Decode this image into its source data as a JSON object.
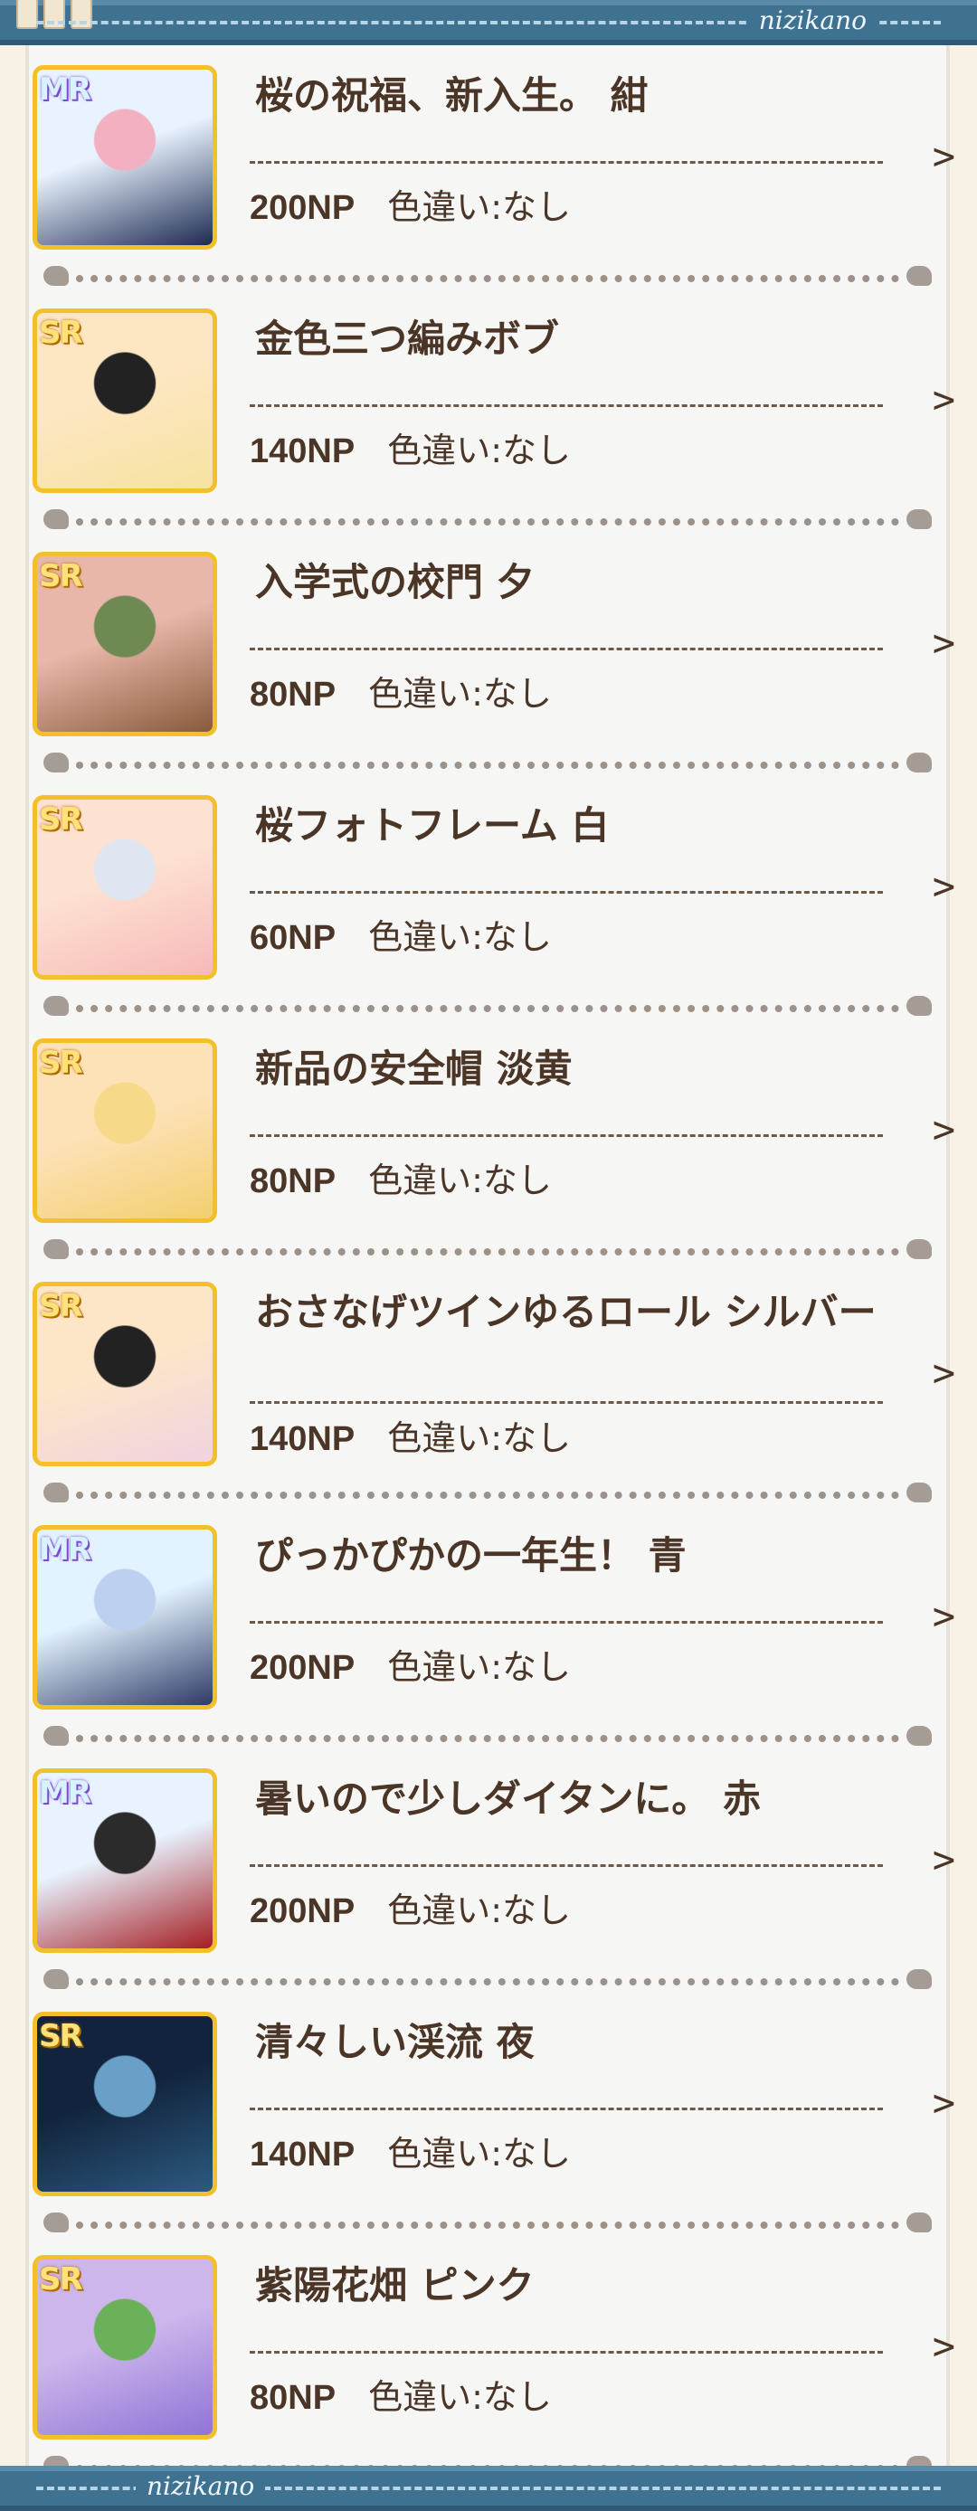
{
  "header": {
    "brand": "nizikano"
  },
  "footer": {
    "brand": "nizikano"
  },
  "items": [
    {
      "rarity": "MR",
      "name": "桜の祝福、新入生。 紺",
      "price": "200NP",
      "variant": "色違い:なし",
      "colors": [
        "#e9f3ff",
        "#1d2b52",
        "#f3b0c0"
      ]
    },
    {
      "rarity": "SR",
      "name": "金色三つ編みボブ",
      "price": "140NP",
      "variant": "色違い:なし",
      "colors": [
        "#fde6c2",
        "#f6e3a0",
        "#222222"
      ]
    },
    {
      "rarity": "SR",
      "name": "入学式の校門 夕",
      "price": "80NP",
      "variant": "色違い:なし",
      "colors": [
        "#e8b7a9",
        "#8a5a3c",
        "#6e8a52"
      ]
    },
    {
      "rarity": "SR",
      "name": "桜フォトフレーム 白",
      "price": "60NP",
      "variant": "色違い:なし",
      "colors": [
        "#fde1d1",
        "#f7b9b9",
        "#dfe6f2"
      ]
    },
    {
      "rarity": "SR",
      "name": "新品の安全帽 淡黄",
      "price": "80NP",
      "variant": "色違い:なし",
      "colors": [
        "#fde2b8",
        "#f3cf70",
        "#f7d98a"
      ]
    },
    {
      "rarity": "SR",
      "name": "おさなげツインゆるロール シルバー",
      "price": "140NP",
      "variant": "色違い:なし",
      "colors": [
        "#fde6c8",
        "#f1d2e0",
        "#222222"
      ]
    },
    {
      "rarity": "MR",
      "name": "ぴっかぴかの一年生！ 青",
      "price": "200NP",
      "variant": "色違い:なし",
      "colors": [
        "#e3f2ff",
        "#2f3a66",
        "#bdd0f0"
      ]
    },
    {
      "rarity": "MR",
      "name": "暑いので少しダイタンに。 赤",
      "price": "200NP",
      "variant": "色違い:なし",
      "colors": [
        "#e8f3ff",
        "#a51d22",
        "#2b2b2b"
      ]
    },
    {
      "rarity": "SR",
      "name": "清々しい渓流 夜",
      "price": "140NP",
      "variant": "色違い:なし",
      "colors": [
        "#12243d",
        "#2c5a80",
        "#6aa0c8"
      ]
    },
    {
      "rarity": "SR",
      "name": "紫陽花畑 ピンク",
      "price": "80NP",
      "variant": "色違い:なし",
      "colors": [
        "#cdb6ec",
        "#8f74d6",
        "#6ab15a"
      ]
    }
  ]
}
